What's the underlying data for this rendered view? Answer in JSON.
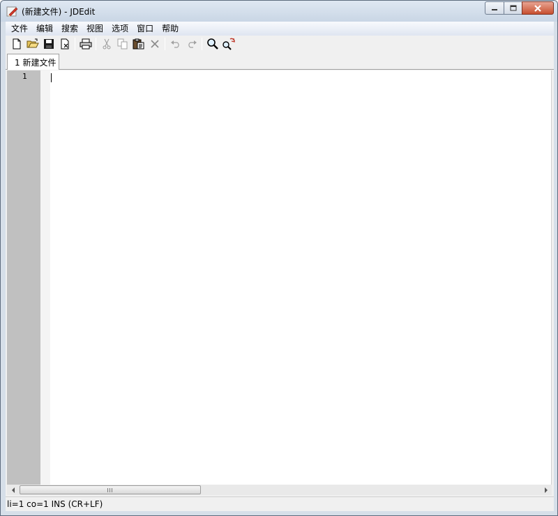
{
  "window": {
    "title": "(新建文件) - JDEdit",
    "buttons": {
      "minimize": "minimize",
      "maximize": "maximize",
      "close": "close"
    }
  },
  "menubar": {
    "items": [
      {
        "label": "文件"
      },
      {
        "label": "编辑"
      },
      {
        "label": "搜索"
      },
      {
        "label": "视图"
      },
      {
        "label": "选项"
      },
      {
        "label": "窗口"
      },
      {
        "label": "帮助"
      }
    ]
  },
  "toolbar": {
    "buttons": [
      {
        "icon": "new-file-icon",
        "enabled": true
      },
      {
        "icon": "open-folder-icon",
        "enabled": true
      },
      {
        "icon": "save-icon",
        "enabled": true
      },
      {
        "icon": "close-file-icon",
        "enabled": true
      },
      {
        "icon": "print-icon",
        "enabled": true
      },
      {
        "icon": "cut-icon",
        "enabled": false
      },
      {
        "icon": "copy-icon",
        "enabled": false
      },
      {
        "icon": "paste-icon",
        "enabled": true
      },
      {
        "icon": "delete-icon",
        "enabled": false
      },
      {
        "icon": "undo-icon",
        "enabled": false
      },
      {
        "icon": "redo-icon",
        "enabled": false
      },
      {
        "icon": "find-icon",
        "enabled": true
      },
      {
        "icon": "replace-icon",
        "enabled": true
      }
    ]
  },
  "tabs": [
    {
      "label": "1 新建文件",
      "active": true
    }
  ],
  "editor": {
    "line_numbers": [
      "1"
    ],
    "content": ""
  },
  "statusbar": {
    "text": "li=1 co=1 INS (CR+LF)"
  },
  "colors": {
    "gutter": "#c0c0c0",
    "close_button": "#c7502f",
    "editor_bg": "#ffffff"
  }
}
